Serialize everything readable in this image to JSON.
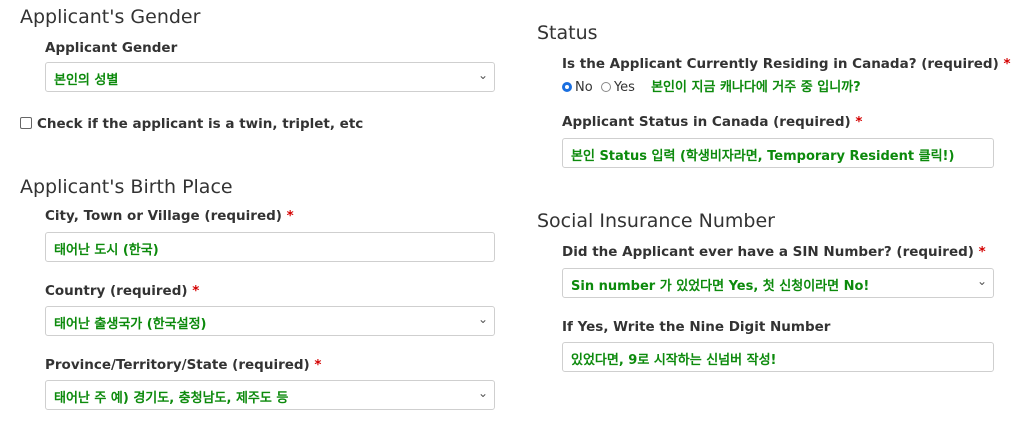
{
  "gender": {
    "title": "Applicant's Gender",
    "label": "Applicant Gender",
    "value": "본인의 성별",
    "twin_label": "Check if the applicant is a twin, triplet, etc"
  },
  "birth": {
    "title": "Applicant's Birth Place",
    "city_label": "City, Town or Village (required)",
    "city_value": "태어난 도시 (한국)",
    "country_label": "Country (required)",
    "country_value": "태어난 출생국가 (한국설정)",
    "province_label": "Province/Territory/State (required)",
    "province_value": "태어난 주 예) 경기도, 충청남도, 제주도 등"
  },
  "status": {
    "title": "Status",
    "residing_label": "Is the Applicant Currently Residing in Canada? (required)",
    "no_label": "No",
    "yes_label": "Yes",
    "residing_hint": "본인이 지금 캐나다에 거주 중 입니까?",
    "status_label": "Applicant Status in Canada (required)",
    "status_value": "본인 Status 입력 (학생비자라면, Temporary Resident 클릭!)"
  },
  "sin": {
    "title": "Social Insurance Number",
    "had_label": "Did the Applicant ever have a SIN Number? (required)",
    "had_value": "Sin number 가 있었다면 Yes, 첫 신청이라면 No!",
    "number_label": "If Yes, Write the Nine Digit Number",
    "number_value": "있었다면, 9로 시작하는 신넘버 작성!"
  },
  "required_mark": "*",
  "icons": {
    "chevron": "chevron-down-icon",
    "radio_selected": "No"
  },
  "colors": {
    "hint_green": "#0c8a0c",
    "required_red": "#d40000",
    "radio_blue": "#1a6fe0"
  }
}
